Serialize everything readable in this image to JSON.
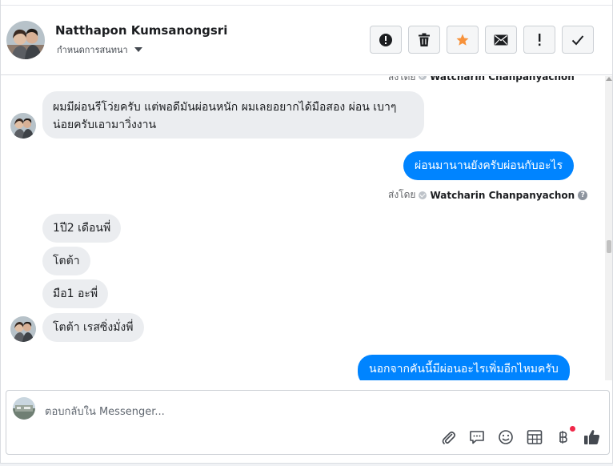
{
  "header": {
    "contact_name": "Natthapon Kumsanongsri",
    "subtitle": "กำหนดการสนทนา",
    "actions": [
      {
        "name": "report-button",
        "icon": "exclamation-circle-icon"
      },
      {
        "name": "delete-button",
        "icon": "trash-icon"
      },
      {
        "name": "star-button",
        "icon": "star-icon",
        "color": "#f7923b"
      },
      {
        "name": "mark-unread-button",
        "icon": "envelope-icon"
      },
      {
        "name": "flag-button",
        "icon": "exclamation-icon"
      },
      {
        "name": "mark-done-button",
        "icon": "checkmark-icon"
      }
    ]
  },
  "chat": {
    "top_cut_meta": {
      "prefix": "ส่งโดย",
      "name": "Watcharin Chanpanyachon"
    },
    "messages": [
      {
        "side": "in",
        "text": "ผมมีผ่อนรีโว่ยครับ แต่พอดีมันผ่อนหนัก  ผมเลยอยากได้มือสอง ผ่อน เบาๆน่อยครับเอามาวิ่งงาน"
      },
      {
        "side": "out",
        "text": "ผ่อนมานานยังครับผ่อนกับอะไร"
      },
      {
        "side": "in",
        "text": "1ปี2 เดือนพี่"
      },
      {
        "side": "in",
        "text": "โตต้า"
      },
      {
        "side": "in",
        "text": "มือ1 อะพี่"
      },
      {
        "side": "in",
        "text": "โตต้า เรสซิ่งมั่งพี่"
      },
      {
        "side": "out",
        "text": "นอกจากคันนี้มีผ่อนอะไรเพิ่มอีกไหมครับ"
      }
    ],
    "sent_by": {
      "prefix": "ส่งโดย",
      "name": "Watcharin Chanpanyachon",
      "help": "?"
    }
  },
  "composer": {
    "placeholder": "ตอบกลับใน Messenger...",
    "tools": [
      "paperclip-icon",
      "speech-bubble-icon",
      "smiley-icon",
      "table-icon",
      "baht-icon",
      "thumbs-up-icon"
    ]
  },
  "colors": {
    "accent_blue": "#0084ff",
    "incoming_bubble": "#ebedf0",
    "star": "#f7923b"
  }
}
